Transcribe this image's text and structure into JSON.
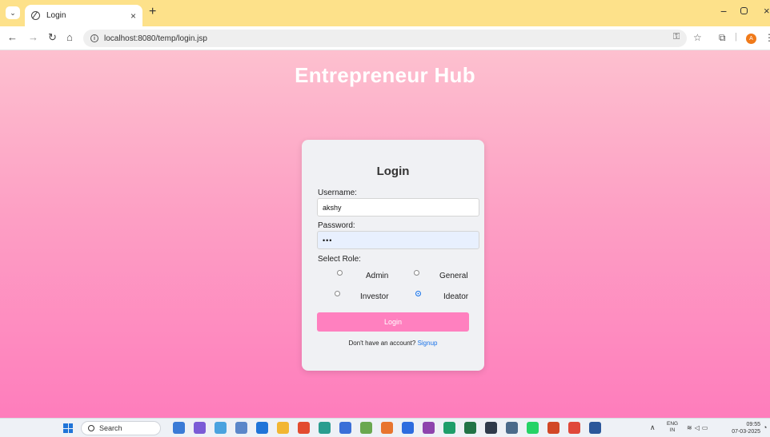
{
  "browser": {
    "tab_title": "Login",
    "tab_close": "×",
    "new_tab": "+",
    "url": "localhost:8080/temp/login.jsp",
    "profile_initial": "A"
  },
  "page": {
    "site_title": "Entrepreneur Hub"
  },
  "login_card": {
    "title": "Login",
    "username_label": "Username:",
    "username_value": "akshy",
    "password_label": "Password:",
    "password_value": "abc",
    "role_label": "Select Role:",
    "roles": [
      {
        "label": "Admin",
        "checked": false
      },
      {
        "label": "General",
        "checked": false
      },
      {
        "label": "Investor",
        "checked": false
      },
      {
        "label": "Ideator",
        "checked": true
      }
    ],
    "button_label": "Login",
    "signup_prompt": "Don't have an account?",
    "signup_link": "Signup"
  },
  "taskbar": {
    "search_label": "Search",
    "lang_top": "ENG",
    "lang_bottom": "IN",
    "time": "09:55",
    "date": "07-03-2025",
    "app_colors": [
      "#3b7bd6",
      "#7b5cd6",
      "#4aa3df",
      "#5b87c9",
      "#1f74d8",
      "#f2b632",
      "#e34b2f",
      "#2a9d8f",
      "#3a6fd8",
      "#6aa84f",
      "#e8752f",
      "#2d6cdf",
      "#8e44ad",
      "#1e9e6a",
      "#217346",
      "#2f3a4a",
      "#4b6a8a",
      "#25d366",
      "#d24726",
      "#e0483a",
      "#2b579a"
    ]
  }
}
